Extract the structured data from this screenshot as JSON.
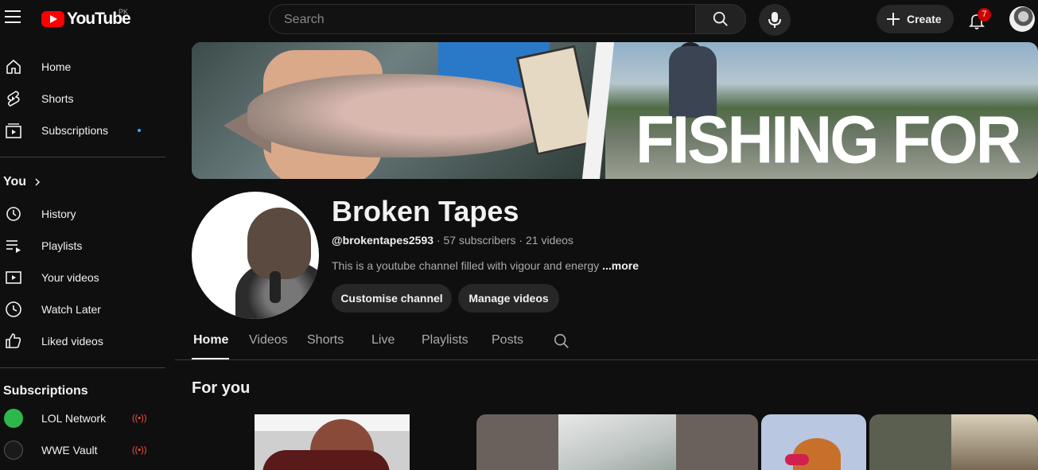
{
  "header": {
    "logo_text": "YouTube",
    "country_code": "PK",
    "search_placeholder": "Search",
    "create_label": "Create",
    "notification_count": "7"
  },
  "sidebar": {
    "main": [
      {
        "label": "Home",
        "icon": "home-icon"
      },
      {
        "label": "Shorts",
        "icon": "shorts-icon"
      },
      {
        "label": "Subscriptions",
        "icon": "subscriptions-icon"
      }
    ],
    "you_title": "You",
    "you_items": [
      {
        "label": "History",
        "icon": "history-icon"
      },
      {
        "label": "Playlists",
        "icon": "playlists-icon"
      },
      {
        "label": "Your videos",
        "icon": "your-videos-icon"
      },
      {
        "label": "Watch Later",
        "icon": "watch-later-icon"
      },
      {
        "label": "Liked videos",
        "icon": "liked-videos-icon"
      }
    ],
    "subscriptions_title": "Subscriptions",
    "subscriptions": [
      {
        "label": "LOL Network",
        "avatar_color": "#2db84c",
        "live": true
      },
      {
        "label": "WWE Vault",
        "avatar_color": "#1a1a1a",
        "live": true
      }
    ]
  },
  "banner": {
    "text": "FISHING FOR"
  },
  "channel": {
    "name": "Broken Tapes",
    "handle": "@brokentapes2593",
    "subscribers": "57 subscribers",
    "videos": "21 videos",
    "separator": " · ",
    "description": "This is a youtube channel filled with vigour and energy ",
    "more_label": "...more",
    "customise_label": "Customise channel",
    "manage_label": "Manage videos"
  },
  "tabs": [
    {
      "label": "Home",
      "active": true
    },
    {
      "label": "Videos",
      "active": false
    },
    {
      "label": "Shorts",
      "active": false
    },
    {
      "label": "Live",
      "active": false
    },
    {
      "label": "Playlists",
      "active": false
    },
    {
      "label": "Posts",
      "active": false
    }
  ],
  "section_title": "For you",
  "colors": {
    "background": "#0f0f0f",
    "brand_red": "#ff0000",
    "badge_red": "#cc0000",
    "accent_blue": "#3ea6ff"
  }
}
